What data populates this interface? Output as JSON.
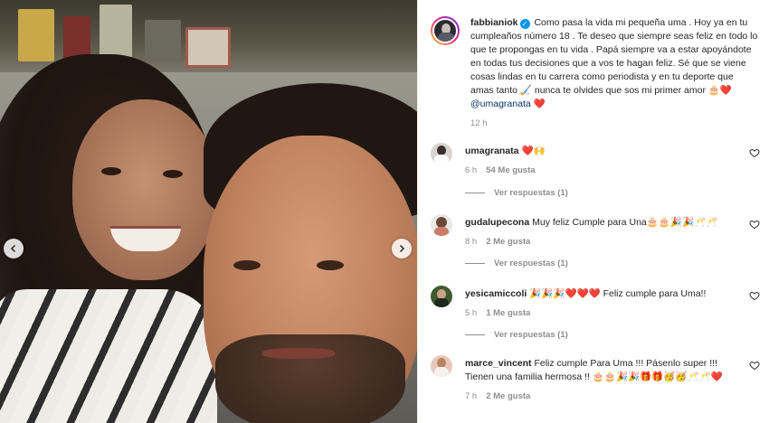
{
  "post": {
    "author": "fabbianiok",
    "caption": "Como pasa la vida mi pequeña uma . Hoy ya en tu cumpleaños número 18 . Te deseo que siempre seas feliz en todo lo que te propongas en tu vida . Papá siempre va a estar apoyándote en todas tus decisiones que a vos te hagan feliz. Sé que se viene cosas lindas en tu carrera como periodista y en tu deporte que amas tanto 🏑 nunca te olvides que sos mi primer amor 🎂❤️",
    "mention": "@umagranata",
    "caption_end": "❤️",
    "time": "12 h"
  },
  "comments": [
    {
      "user": "umagranata",
      "text": "❤️🙌",
      "time": "6 h",
      "likes": "54 Me gusta",
      "replies": "Ver respuestas (1)"
    },
    {
      "user": "gudalupecona",
      "text": "Muy feliz Cumple para Una🎂🎂🎉🎉🥂🥂",
      "time": "8 h",
      "likes": "2 Me gusta",
      "replies": "Ver respuestas (1)"
    },
    {
      "user": "yesicamiccoli",
      "text": "🎉🎉🎉❤️❤️❤️ Feliz cumple para Uma!!",
      "time": "5 h",
      "likes": "1 Me gusta",
      "replies": "Ver respuestas (1)"
    },
    {
      "user": "marce_vincent",
      "text": "Feliz cumple Para Uma !!! Pásenlo super !!! Tienen una familia hermosa !! 🎂🎂🎉🎉🎁🎁🥳🥳🥂🥂❤️",
      "time": "7 h",
      "likes": "2 Me gusta"
    }
  ],
  "colors": {
    "link": "#00376b",
    "verified": "#0095f6",
    "muted": "#8e8e8e"
  }
}
